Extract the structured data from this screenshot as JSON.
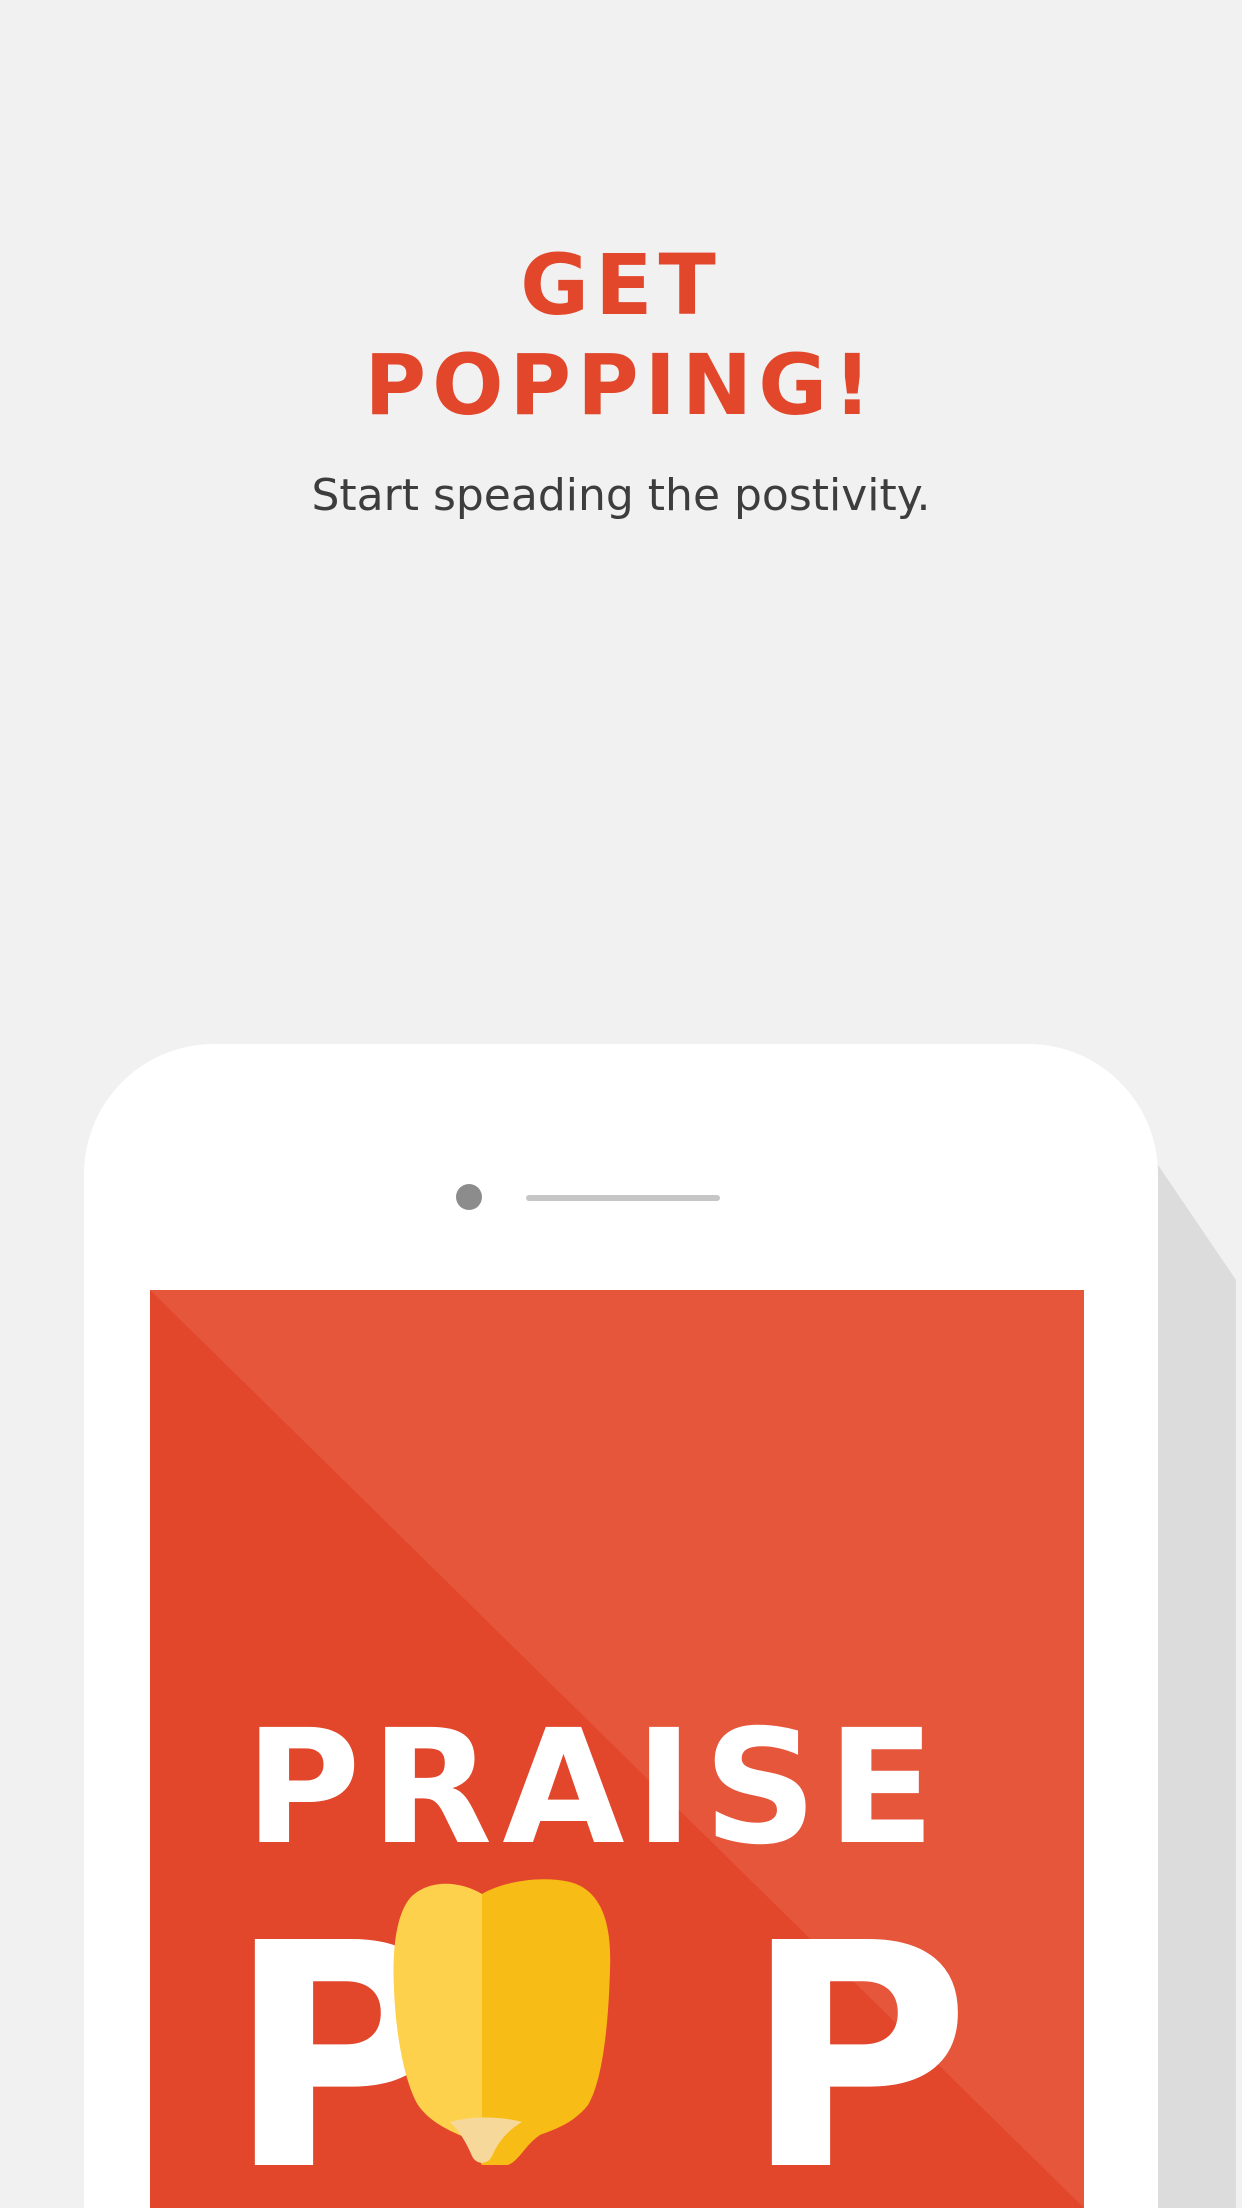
{
  "onboarding": {
    "headline_line1": "GET",
    "headline_line2": "POPPING!",
    "tagline": "Start speading the postivity."
  },
  "app_logo": {
    "line1": "PRAISE",
    "line2_left": "P",
    "line2_right": "P",
    "kernel_icon": "popcorn-kernel-icon"
  },
  "colors": {
    "background": "#f1f1f1",
    "accent": "#e2462b",
    "accent_light": "#e5563b",
    "text": "#3d3d3d",
    "kernel_light": "#fed14d",
    "kernel_dark": "#f8bc17",
    "kernel_tip": "#f6d99a"
  }
}
